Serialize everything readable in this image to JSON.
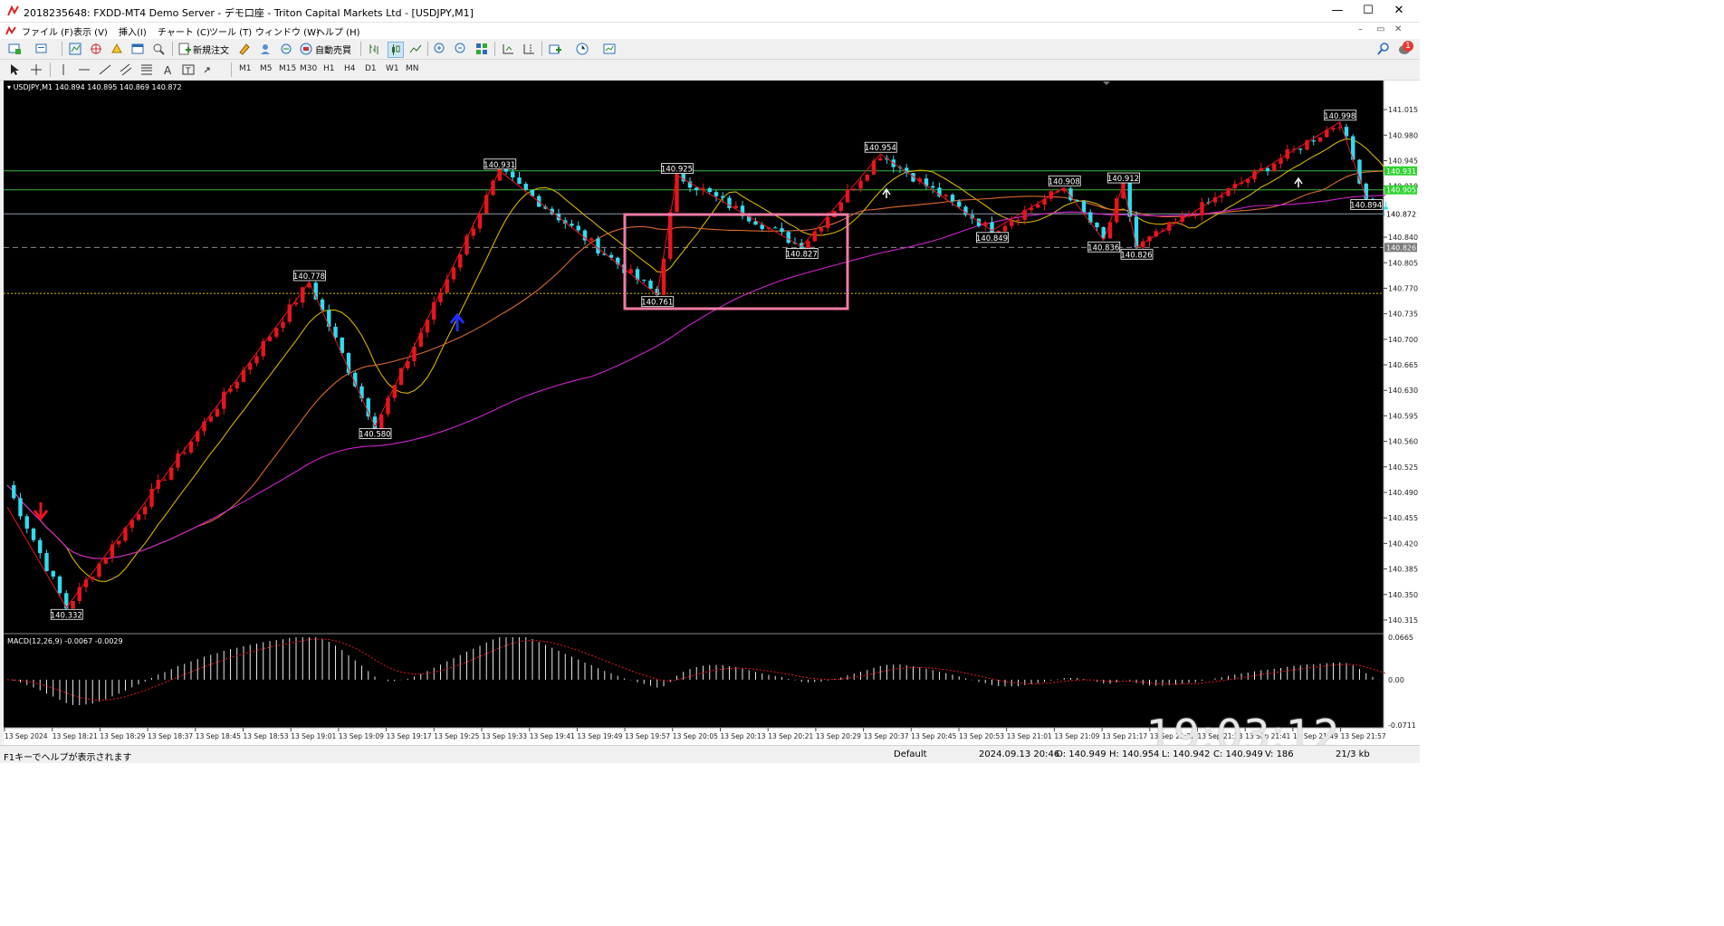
{
  "window": {
    "title": "2018235648: FXDD-MT4 Demo Server - デモ口座 - Triton Capital Markets Ltd - [USDJPY,M1]",
    "minimize": "—",
    "maximize": "☐",
    "close": "✕"
  },
  "menu": [
    "ファイル (F)",
    "表示 (V)",
    "挿入(I)",
    "チャート (C)",
    "ツール (T)",
    "ウィンドウ (W)",
    "ヘルプ (H)"
  ],
  "toolbar": {
    "new_order": "新規注文",
    "auto_trade": "自動売買",
    "notification_count": "1"
  },
  "timeframes": [
    "M1",
    "M5",
    "M15",
    "M30",
    "H1",
    "H4",
    "D1",
    "W1",
    "MN"
  ],
  "colors": {
    "bull": "#e8141f",
    "bear": "#31dcef",
    "ma_fast": "#d4b200",
    "ma_mid": "#d9692d",
    "ma_slow": "#cc22cc",
    "zigzag": "#e8141f",
    "hline": "#3bb83b",
    "box": "#f07ba6",
    "macd_hist": "#e6e6e6",
    "macd_signal": "#e8141f"
  },
  "chart_data": {
    "type": "candlestick",
    "symbol_label": "USDJPY,M1",
    "ohlc_label": "140.894 140.895 140.869 140.872",
    "price_axis": [
      "141.015",
      "140.980",
      "140.945",
      "140.910",
      "140.872",
      "140.840",
      "140.805",
      "140.770",
      "140.735",
      "140.700",
      "140.665",
      "140.630",
      "140.595",
      "140.560",
      "140.525",
      "140.490",
      "140.455",
      "140.420",
      "140.385",
      "140.350",
      "140.315"
    ],
    "ylim": [
      140.31,
      141.03
    ],
    "time_axis": [
      "13 Sep 2024",
      "13 Sep 18:21",
      "13 Sep 18:29",
      "13 Sep 18:37",
      "13 Sep 18:45",
      "13 Sep 18:53",
      "13 Sep 19:01",
      "13 Sep 19:09",
      "13 Sep 19:17",
      "13 Sep 19:25",
      "13 Sep 19:33",
      "13 Sep 19:41",
      "13 Sep 19:49",
      "13 Sep 19:57",
      "13 Sep 20:05",
      "13 Sep 20:13",
      "13 Sep 20:21",
      "13 Sep 20:29",
      "13 Sep 20:37",
      "13 Sep 20:45",
      "13 Sep 20:53",
      "13 Sep 21:01",
      "13 Sep 21:09",
      "13 Sep 21:17",
      "13 Sep 21:25",
      "13 Sep 21:33",
      "13 Sep 21:41",
      "13 Sep 21:49",
      "13 Sep 21:57"
    ],
    "price_tags": [
      {
        "text": "140.931",
        "price": 140.931,
        "color": "#2fd12f"
      },
      {
        "text": "140.905",
        "price": 140.905,
        "color": "#2fd12f"
      },
      {
        "text": "140.872",
        "price": 140.872,
        "color": "#ffffff"
      },
      {
        "text": "140.826",
        "price": 140.826,
        "color": "#7a7a7a"
      }
    ],
    "horizontal_lines": [
      {
        "price": 140.931,
        "style": "solid",
        "color": "#3bb83b"
      },
      {
        "price": 140.905,
        "style": "solid",
        "color": "#3bb83b"
      },
      {
        "price": 140.872,
        "style": "solid",
        "color": "#8f9aa8"
      },
      {
        "price": 140.826,
        "style": "dashed",
        "color": "#8a8a8a"
      },
      {
        "price": 140.763,
        "style": "dotted",
        "color": "#d6c200"
      }
    ],
    "zigzag_labels": [
      {
        "text": "140.332",
        "price": 140.332,
        "index": 9
      },
      {
        "text": "140.778",
        "price": 140.778,
        "index": 46
      },
      {
        "text": "140.580",
        "price": 140.58,
        "index": 56
      },
      {
        "text": "140.931",
        "price": 140.931,
        "index": 75
      },
      {
        "text": "140.761",
        "price": 140.761,
        "index": 99
      },
      {
        "text": "140.925",
        "price": 140.925,
        "index": 102
      },
      {
        "text": "140.827",
        "price": 140.827,
        "index": 121
      },
      {
        "text": "140.954",
        "price": 140.954,
        "index": 133
      },
      {
        "text": "140.849",
        "price": 140.849,
        "index": 150
      },
      {
        "text": "140.908",
        "price": 140.908,
        "index": 161
      },
      {
        "text": "140.836",
        "price": 140.836,
        "index": 167
      },
      {
        "text": "140.912",
        "price": 140.912,
        "index": 170
      },
      {
        "text": "140.826",
        "price": 140.826,
        "index": 172
      },
      {
        "text": "140.998",
        "price": 140.998,
        "index": 203
      },
      {
        "text": "140.894",
        "price": 140.894,
        "index": 207
      }
    ],
    "macd": {
      "label": "MACD(12,26,9) -0.0067 -0.0029",
      "axis": [
        "0.0665",
        "0.00",
        "-0.0711"
      ],
      "ylim": [
        -0.0711,
        0.0665
      ]
    }
  },
  "status": {
    "help": "F1キーでヘルプが表示されます",
    "profile": "Default",
    "datetime": "2024.09.13 20:46",
    "open": "O: 140.949",
    "high": "H: 140.954",
    "low": "L: 140.942",
    "close": "C: 140.949",
    "volume": "V: 186",
    "traffic": "21/3 kb"
  },
  "clock_overlay": "19:03:12"
}
